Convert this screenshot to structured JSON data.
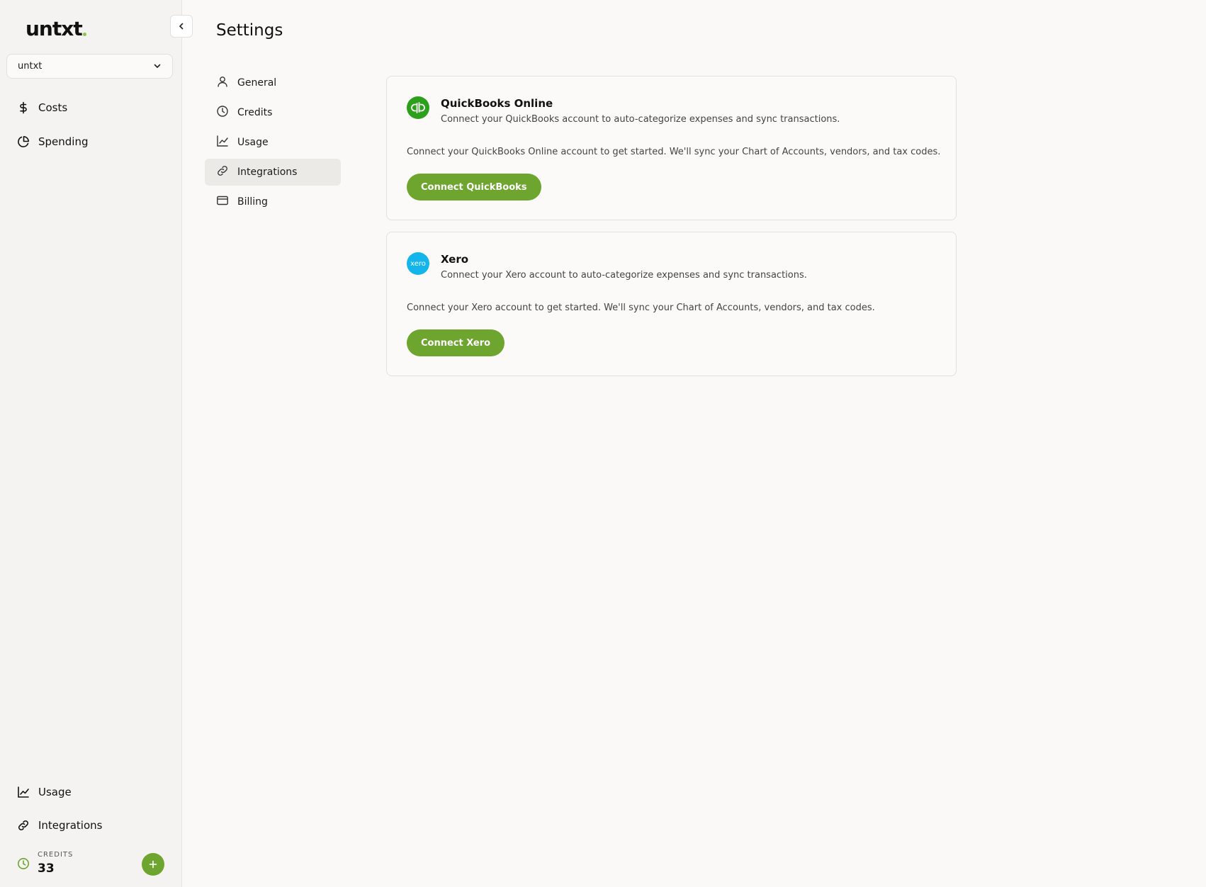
{
  "app": {
    "logo_text": "untxt",
    "workspace": "untxt"
  },
  "sidebar": {
    "top_items": [
      {
        "label": "Costs",
        "icon": "dollar-icon"
      },
      {
        "label": "Spending",
        "icon": "pie-chart-icon"
      }
    ],
    "bottom_items": [
      {
        "label": "Usage",
        "icon": "line-chart-icon"
      },
      {
        "label": "Integrations",
        "icon": "link-icon"
      }
    ],
    "credits": {
      "label": "CREDITS",
      "value": "33"
    }
  },
  "page": {
    "title": "Settings"
  },
  "settings_nav": [
    {
      "label": "General",
      "icon": "user-icon"
    },
    {
      "label": "Credits",
      "icon": "clock-icon"
    },
    {
      "label": "Usage",
      "icon": "line-chart-icon"
    },
    {
      "label": "Integrations",
      "icon": "link-icon",
      "active": true
    },
    {
      "label": "Billing",
      "icon": "credit-card-icon"
    }
  ],
  "integrations": [
    {
      "name": "QuickBooks Online",
      "subtitle": "Connect your QuickBooks account to auto-categorize expenses and sync transactions.",
      "description": "Connect your QuickBooks Online account to get started. We'll sync your Chart of Accounts, vendors, and tax codes.",
      "button": "Connect QuickBooks",
      "logo_text": "qb",
      "color": "#2ca01c"
    },
    {
      "name": "Xero",
      "subtitle": "Connect your Xero account to auto-categorize expenses and sync transactions.",
      "description": "Connect your Xero account to get started. We'll sync your Chart of Accounts, vendors, and tax codes.",
      "button": "Connect Xero",
      "logo_text": "xero",
      "color": "#13b5ea"
    }
  ],
  "colors": {
    "accent": "#6ea52f",
    "logo_dot": "#8bc34a"
  }
}
